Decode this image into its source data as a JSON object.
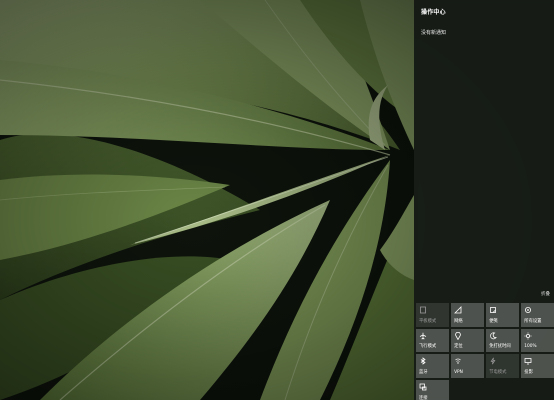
{
  "action_center": {
    "title": "操作中心",
    "no_notifications": "没有新通知",
    "collapse_label": "折叠"
  },
  "tiles": [
    {
      "label": "平板模式",
      "icon": "tablet-mode-icon",
      "state": "off"
    },
    {
      "label": "网络",
      "icon": "network-icon",
      "state": "active"
    },
    {
      "label": "便笺",
      "icon": "note-icon",
      "state": "active"
    },
    {
      "label": "所有设置",
      "icon": "settings-gear-icon",
      "state": "active"
    },
    {
      "label": "飞行模式",
      "icon": "airplane-icon",
      "state": "active"
    },
    {
      "label": "定位",
      "icon": "location-icon",
      "state": "active"
    },
    {
      "label": "免打扰时间",
      "icon": "moon-icon",
      "state": "active"
    },
    {
      "label": "100%",
      "icon": "brightness-icon",
      "state": "active"
    },
    {
      "label": "蓝牙",
      "icon": "bluetooth-icon",
      "state": "active"
    },
    {
      "label": "VPN",
      "icon": "vpn-icon",
      "state": "active"
    },
    {
      "label": "节电模式",
      "icon": "battery-saver-icon",
      "state": "off"
    },
    {
      "label": "投影",
      "icon": "project-icon",
      "state": "active"
    },
    {
      "label": "连接",
      "icon": "connect-icon",
      "state": "active"
    }
  ],
  "colors": {
    "panel_bg": "#202620",
    "tile_bg": "#6e6e6e",
    "leaf_green": "#6f8a4a"
  }
}
